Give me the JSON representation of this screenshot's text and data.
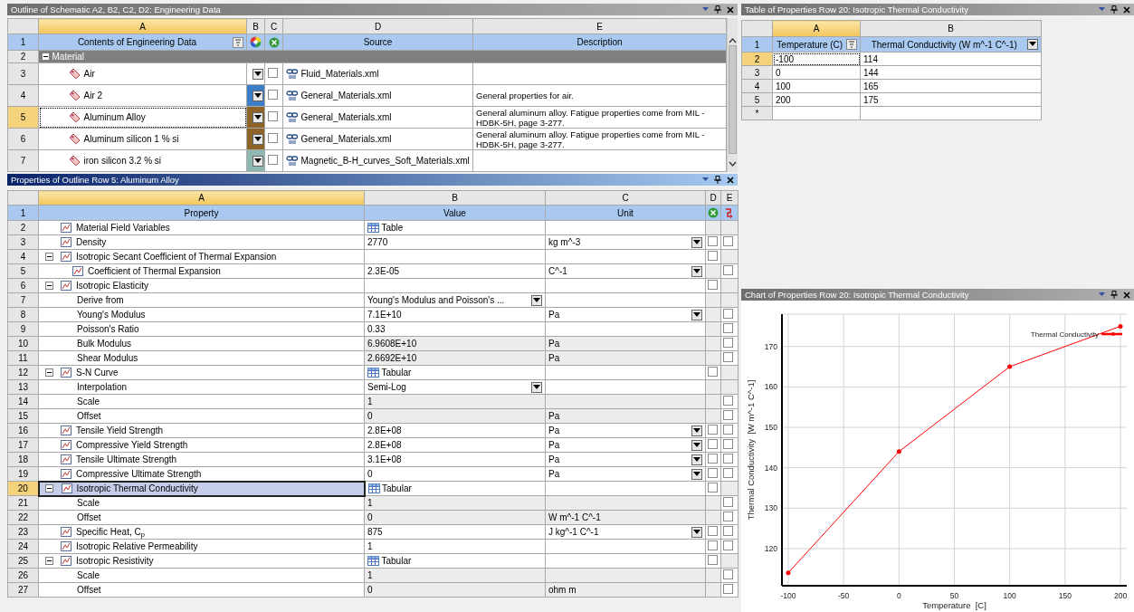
{
  "outline": {
    "title": "Outline of Schematic A2, B2, C2, D2: Engineering Data",
    "active": false,
    "columns": [
      {
        "label": "A",
        "selected": true
      },
      {
        "label": "B",
        "selected": false
      },
      {
        "label": "C",
        "selected": false
      },
      {
        "label": "D",
        "selected": false
      },
      {
        "label": "E",
        "selected": false
      }
    ],
    "header": {
      "num": "1",
      "contents": "Contents of Engineering Data",
      "source": "Source",
      "description": "Description"
    },
    "rows": [
      {
        "num": "2",
        "label": "Material",
        "expanded": true,
        "selected": false,
        "children": [
          {
            "num": "3",
            "name": "Air",
            "color": "#ffffff",
            "checked": false,
            "source": "Fluid_Materials.xml",
            "selected": false
          },
          {
            "num": "4",
            "name": "Air 2",
            "color": "#3c7dc8",
            "checked": false,
            "source": "General_Materials.xml",
            "description": "General properties for air.",
            "selected": false
          },
          {
            "num": "5",
            "name": "Aluminum Alloy",
            "color": "#8c6428",
            "checked": false,
            "source": "General_Materials.xml",
            "description": "General aluminum alloy. Fatigue properties come from MIL -HDBK-5H, page 3-277.",
            "selected": true
          },
          {
            "num": "6",
            "name": "Aluminum silicon 1 % si",
            "color": "#8c6428",
            "checked": false,
            "source": "General_Materials.xml",
            "description": "General aluminum alloy. Fatigue properties come from MIL -HDBK-5H, page 3-277.",
            "selected": false
          },
          {
            "num": "7",
            "name": "iron silicon 3.2 % si",
            "color": "#8fb8b2",
            "checked": false,
            "source": "Magnetic_B-H_curves_Soft_Materials.xml",
            "selected": false
          }
        ]
      }
    ]
  },
  "properties": {
    "title": "Properties of Outline Row 5: Aluminum Alloy",
    "active": true,
    "columns": [
      {
        "label": "A",
        "selected": true
      },
      {
        "label": "B",
        "selected": false
      },
      {
        "label": "C",
        "selected": false
      },
      {
        "label": "D",
        "selected": false
      },
      {
        "label": "E",
        "selected": false
      }
    ],
    "header": {
      "num": "1",
      "property": "Property",
      "value": "Value",
      "unit": "Unit"
    },
    "rows": [
      {
        "num": "2",
        "label": "Material Field Variables",
        "icon": true,
        "value": "Table",
        "table_icon": true,
        "selected": false
      },
      {
        "num": "3",
        "label": "Density",
        "icon": true,
        "value": "2770",
        "unit": "kg m^-3",
        "unit_dropdown": true,
        "d": false,
        "e": false,
        "selected": false
      },
      {
        "num": "4",
        "label": "Isotropic Secant Coefficient of Thermal Expansion",
        "icon": true,
        "expanded": true,
        "d": false,
        "selected": false,
        "children": [
          {
            "num": "5",
            "label": "Coefficient of Thermal Expansion",
            "icon": true,
            "value": "2.3E-05",
            "unit": "C^-1",
            "unit_dropdown": true,
            "e": false,
            "selected": false
          }
        ]
      },
      {
        "num": "6",
        "label": "Isotropic Elasticity",
        "icon": true,
        "expanded": true,
        "d": false,
        "selected": false,
        "children": [
          {
            "num": "7",
            "label": "Derive from",
            "value": "Young's Modulus and Poisson's ...",
            "value_dropdown": true,
            "selected": false
          },
          {
            "num": "8",
            "label": "Young's Modulus",
            "value": "7.1E+10",
            "unit": "Pa",
            "unit_dropdown": true,
            "e": false,
            "selected": false
          },
          {
            "num": "9",
            "label": "Poisson's Ratio",
            "value": "0.33",
            "e": false,
            "selected": false
          },
          {
            "num": "10",
            "label": "Bulk Modulus",
            "value": "6.9608E+10",
            "unit": "Pa",
            "readonly": true,
            "e": false,
            "selected": false
          },
          {
            "num": "11",
            "label": "Shear Modulus",
            "value": "2.6692E+10",
            "unit": "Pa",
            "readonly": true,
            "e": false,
            "selected": false
          }
        ]
      },
      {
        "num": "12",
        "label": "S-N Curve",
        "icon": true,
        "expanded": true,
        "value": "Tabular",
        "table_icon": true,
        "d": false,
        "selected": false,
        "children": [
          {
            "num": "13",
            "label": "Interpolation",
            "value": "Semi-Log",
            "value_dropdown": true,
            "selected": false
          },
          {
            "num": "14",
            "label": "Scale",
            "value": "1",
            "readonly": true,
            "e": false,
            "selected": false
          },
          {
            "num": "15",
            "label": "Offset",
            "value": "0",
            "unit": "Pa",
            "readonly": true,
            "e": false,
            "selected": false
          }
        ]
      },
      {
        "num": "16",
        "label": "Tensile Yield Strength",
        "icon": true,
        "value": "2.8E+08",
        "unit": "Pa",
        "unit_dropdown": true,
        "d": false,
        "e": false,
        "selected": false
      },
      {
        "num": "17",
        "label": "Compressive Yield Strength",
        "icon": true,
        "value": "2.8E+08",
        "unit": "Pa",
        "unit_dropdown": true,
        "d": false,
        "e": false,
        "selected": false
      },
      {
        "num": "18",
        "label": "Tensile Ultimate Strength",
        "icon": true,
        "value": "3.1E+08",
        "unit": "Pa",
        "unit_dropdown": true,
        "d": false,
        "e": false,
        "selected": false
      },
      {
        "num": "19",
        "label": "Compressive Ultimate Strength",
        "icon": true,
        "value": "0",
        "unit": "Pa",
        "unit_dropdown": true,
        "d": false,
        "e": false,
        "selected": false
      },
      {
        "num": "20",
        "label": "Isotropic Thermal Conductivity",
        "icon": true,
        "expanded": true,
        "value": "Tabular",
        "table_icon": true,
        "d": false,
        "selected": true,
        "children": [
          {
            "num": "21",
            "label": "Scale",
            "value": "1",
            "readonly": true,
            "e": false,
            "selected": false
          },
          {
            "num": "22",
            "label": "Offset",
            "value": "0",
            "unit": "W m^-1 C^-1",
            "readonly": true,
            "e": false,
            "selected": false
          }
        ]
      },
      {
        "num": "23",
        "label": "Specific Heat, C$_{p}$",
        "icon": true,
        "value": "875",
        "unit": "J kg^-1 C^-1",
        "unit_dropdown": true,
        "d": false,
        "e": false,
        "selected": false
      },
      {
        "num": "24",
        "label": "Isotropic Relative Permeability",
        "icon": true,
        "value": "1",
        "d": false,
        "e": false,
        "selected": false
      },
      {
        "num": "25",
        "label": "Isotropic Resistivity",
        "icon": true,
        "expanded": true,
        "value": "Tabular",
        "table_icon": true,
        "d": false,
        "selected": false,
        "children": [
          {
            "num": "26",
            "label": "Scale",
            "value": "1",
            "readonly": true,
            "e": false,
            "selected": false
          },
          {
            "num": "27",
            "label": "Offset",
            "value": "0",
            "unit": "ohm m",
            "readonly": true,
            "e": false,
            "selected": false
          }
        ]
      }
    ]
  },
  "table": {
    "title": "Table of Properties Row 20: Isotropic Thermal Conductivity",
    "active": false,
    "columns": [
      {
        "label": "A",
        "selected": true
      },
      {
        "label": "B",
        "selected": false
      }
    ],
    "header": {
      "num": "1",
      "temperature": "Temperature (C)",
      "conductivity": "Thermal Conductivity (W m^-1 C^-1)"
    },
    "rows": [
      {
        "num": "2",
        "temperature": "-100",
        "conductivity": "114",
        "selected": true
      },
      {
        "num": "3",
        "temperature": "0",
        "conductivity": "144",
        "selected": false
      },
      {
        "num": "4",
        "temperature": "100",
        "conductivity": "165",
        "selected": false
      },
      {
        "num": "5",
        "temperature": "200",
        "conductivity": "175",
        "selected": false
      }
    ],
    "new_row": {
      "num": "*"
    }
  },
  "chart": {
    "title": "Chart of Properties Row 20: Isotropic Thermal Conductivity",
    "active": false,
    "chart_data": {
      "type": "line",
      "xlabel": "Temperature  [C]",
      "ylabel": "Thermal Conductivity  [W m^-1 C^-1]",
      "x": [
        -100,
        0,
        100,
        200
      ],
      "series": [
        {
          "name": "Thermal Conductivity",
          "color": "#ff0000",
          "values": [
            114,
            144,
            165,
            175
          ]
        }
      ],
      "grid": true,
      "xlim": [
        -105.7,
        205.7
      ],
      "ylim": [
        110.8,
        178
      ],
      "xticks": [
        -100,
        -50,
        0,
        50,
        100,
        150,
        200
      ],
      "yticks": [
        120,
        130,
        140,
        150,
        160,
        170
      ]
    }
  }
}
